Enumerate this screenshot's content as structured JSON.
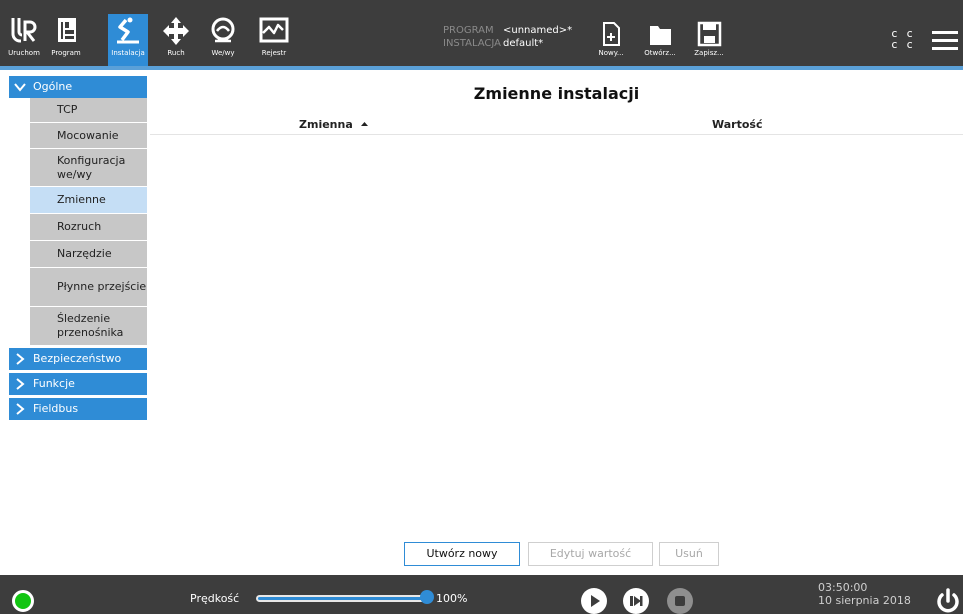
{
  "nav": {
    "items": [
      {
        "label": "Uruchom",
        "icon": "ur-logo-icon"
      },
      {
        "label": "Program",
        "icon": "program-icon"
      },
      {
        "label": "Instalacja",
        "icon": "installation-icon",
        "active": true
      },
      {
        "label": "Ruch",
        "icon": "move-icon"
      },
      {
        "label": "We/wy",
        "icon": "io-icon"
      },
      {
        "label": "Rejestr",
        "icon": "log-icon"
      }
    ]
  },
  "program": {
    "program_key": "PROGRAM",
    "program_value": "<unnamed>*",
    "installation_key": "INSTALACJA",
    "installation_value": "default*"
  },
  "file_buttons": {
    "new_label": "Nowy...",
    "open_label": "Otwórz...",
    "save_label": "Zapisz..."
  },
  "cc": {
    "row1": "c c",
    "row2": "c c"
  },
  "sidebar": {
    "general": {
      "label": "Ogólne",
      "items": [
        {
          "label": "TCP"
        },
        {
          "label": "Mocowanie"
        },
        {
          "label": "Konfiguracja we/wy"
        },
        {
          "label": "Zmienne",
          "selected": true
        },
        {
          "label": "Rozruch"
        },
        {
          "label": "Narzędzie"
        },
        {
          "label": "Płynne przejście"
        },
        {
          "label": "Śledzenie przenośnika"
        }
      ]
    },
    "groups": [
      {
        "label": "Bezpieczeństwo"
      },
      {
        "label": "Funkcje"
      },
      {
        "label": "Fieldbus"
      }
    ]
  },
  "main": {
    "title": "Zmienne instalacji",
    "columns": {
      "variable": "Zmienna",
      "value": "Wartość"
    },
    "actions": {
      "create": "Utwórz nowy",
      "edit": "Edytuj wartość",
      "delete": "Usuń"
    }
  },
  "bottom": {
    "speed_label": "Prędkość",
    "speed_value": "100%",
    "speed_fraction": 1.0,
    "time": "03:50:00",
    "date": "10 sierpnia 2018"
  },
  "colors": {
    "accent": "#2f8cd6",
    "bar": "#3d3d3d",
    "status": "#12c512"
  }
}
